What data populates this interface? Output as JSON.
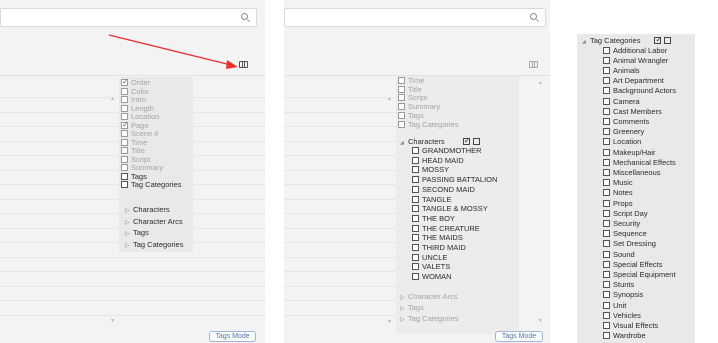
{
  "colors": {
    "accent_arrow": "#e8312f",
    "panel_bg": "#f3f3f3",
    "popup_bg": "#e9e9e9",
    "tags_mode_border": "#9fb8d8"
  },
  "left": {
    "search_placeholder": "",
    "columns_menu": {
      "items": [
        {
          "label": "Order",
          "checked": true,
          "faded": true
        },
        {
          "label": "Color",
          "checked": false,
          "faded": true
        },
        {
          "label": "Intro",
          "checked": false,
          "faded": true
        },
        {
          "label": "Length",
          "checked": false,
          "faded": true
        },
        {
          "label": "Location",
          "checked": false,
          "faded": true
        },
        {
          "label": "Page",
          "checked": true,
          "faded": true
        },
        {
          "label": "Scene #",
          "checked": false,
          "faded": true
        },
        {
          "label": "Time",
          "checked": false,
          "faded": true
        },
        {
          "label": "Title",
          "checked": false,
          "faded": true
        },
        {
          "label": "Script",
          "checked": false,
          "faded": true
        },
        {
          "label": "Summary",
          "checked": false,
          "faded": true
        },
        {
          "label": "Tags",
          "checked": false,
          "faded": false
        },
        {
          "label": "Tag Categories",
          "checked": false,
          "faded": false
        }
      ],
      "groups": [
        "Characters",
        "Character Arcs",
        "Tags",
        "Tag Categories"
      ]
    },
    "tags_mode_label": "Tags Mode"
  },
  "middle": {
    "top_items": [
      "Time",
      "Title",
      "Script",
      "Summary",
      "Tags",
      "Tag Categories"
    ],
    "characters": {
      "header": "Characters",
      "items": [
        "GRANDMOTHER",
        "HEAD MAID",
        "MOSSY",
        "PASSING BATTALION",
        "SECOND MAID",
        "TANGLE",
        "TANGLE & MOSSY",
        "THE BOY",
        "THE CREATURE",
        "THE MAIDS",
        "THIRD MAID",
        "UNCLE",
        "VALETS",
        "WOMAN"
      ]
    },
    "bottom_groups": [
      "Character Arcs",
      "Tags",
      "Tag Categories"
    ],
    "tags_mode_label": "Tags Mode"
  },
  "right": {
    "header": "Tag Categories",
    "items": [
      "Additional Labor",
      "Animal Wrangler",
      "Animals",
      "Art Department",
      "Background Actors",
      "Camera",
      "Cast Members",
      "Comments",
      "Greenery",
      "Location",
      "Makeup/Hair",
      "Mechanical Effects",
      "Miscellaneous",
      "Music",
      "Notes",
      "Props",
      "Script Day",
      "Security",
      "Sequence",
      "Set Dressing",
      "Sound",
      "Special Effects",
      "Special Equipment",
      "Stunts",
      "Synopsis",
      "Unit",
      "Vehicles",
      "Visual Effects",
      "Wardrobe"
    ]
  }
}
